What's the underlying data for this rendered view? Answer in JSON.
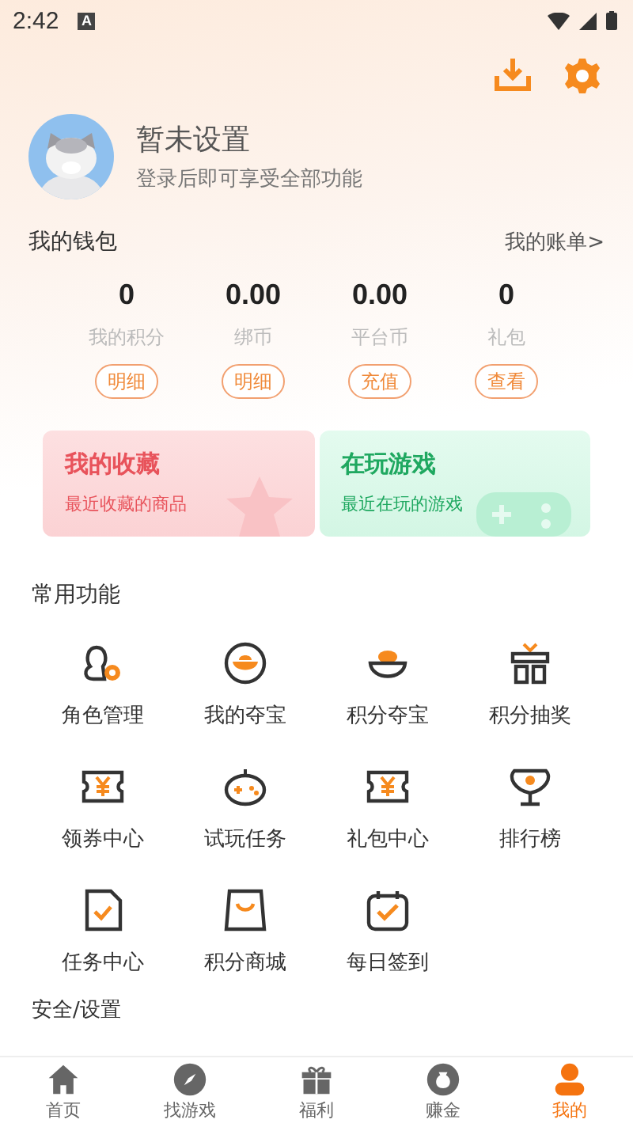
{
  "status_bar": {
    "time": "2:42",
    "notification_icon": "A"
  },
  "profile": {
    "name": "暂未设置",
    "subtitle": "登录后即可享受全部功能"
  },
  "wallet": {
    "title": "我的钱包",
    "link": "我的账单>",
    "stats": [
      {
        "value": "0",
        "label": "我的积分",
        "action": "明细"
      },
      {
        "value": "0.00",
        "label": "绑币",
        "action": "明细"
      },
      {
        "value": "0.00",
        "label": "平台币",
        "action": "充值"
      },
      {
        "value": "0",
        "label": "礼包",
        "action": "查看"
      }
    ]
  },
  "cards": [
    {
      "title": "我的收藏",
      "subtitle": "最近收藏的商品",
      "color": "#e8535b"
    },
    {
      "title": "在玩游戏",
      "subtitle": "最近在玩的游戏",
      "color": "#1fa860"
    }
  ],
  "functions": {
    "title": "常用功能",
    "items": [
      {
        "label": "角色管理"
      },
      {
        "label": "我的夺宝"
      },
      {
        "label": "积分夺宝"
      },
      {
        "label": "积分抽奖"
      },
      {
        "label": "领券中心"
      },
      {
        "label": "试玩任务"
      },
      {
        "label": "礼包中心"
      },
      {
        "label": "排行榜"
      },
      {
        "label": "任务中心"
      },
      {
        "label": "积分商城"
      },
      {
        "label": "每日签到"
      }
    ]
  },
  "security": {
    "title": "安全/设置"
  },
  "nav": [
    {
      "label": "首页",
      "selected": false
    },
    {
      "label": "找游戏",
      "selected": false
    },
    {
      "label": "福利",
      "selected": false
    },
    {
      "label": "赚金",
      "selected": false
    },
    {
      "label": "我的",
      "selected": true
    }
  ]
}
